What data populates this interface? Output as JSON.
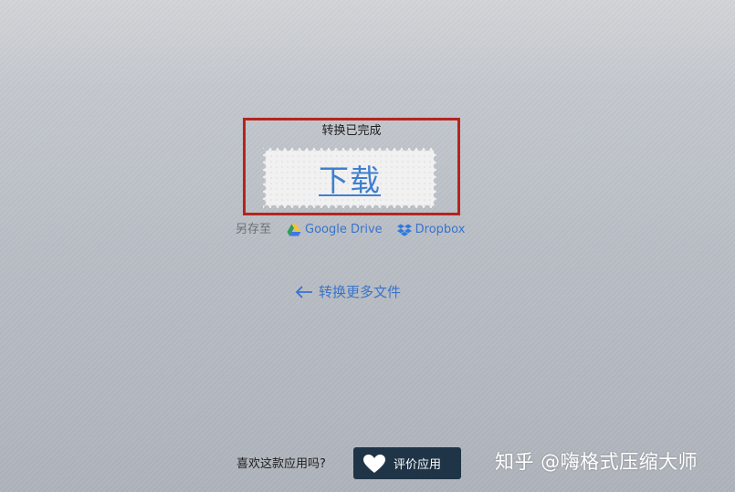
{
  "conversion": {
    "status": "转换已完成",
    "download_label": "下载"
  },
  "save_to": {
    "label": "另存至",
    "google_drive": "Google Drive",
    "dropbox": "Dropbox",
    "google_drive_icon": "google-drive-icon",
    "dropbox_icon": "dropbox-icon"
  },
  "convert_more": {
    "label": "转换更多文件",
    "icon": "arrow-left-icon"
  },
  "rating": {
    "question": "喜欢这款应用吗?",
    "button_label": "评价应用",
    "icon": "heart-icon"
  },
  "watermark": {
    "text": "知乎 @嗨格式压缩大师"
  },
  "colors": {
    "highlight_border": "#b5251e",
    "link": "#3a73c9",
    "download_text": "#3f7fd0",
    "rate_button_bg": "#1f3547"
  }
}
